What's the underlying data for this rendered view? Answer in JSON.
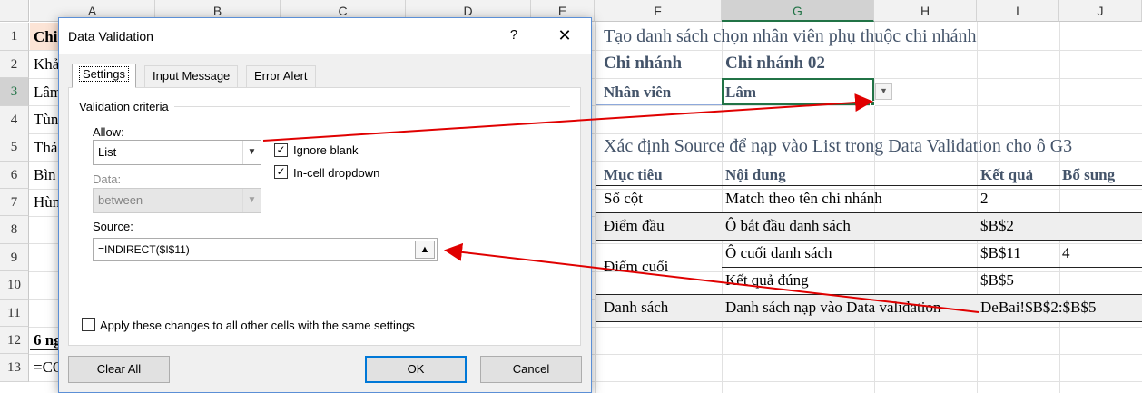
{
  "columns": [
    "A",
    "B",
    "C",
    "D",
    "E",
    "F",
    "G",
    "H",
    "I",
    "J"
  ],
  "rows": [
    "1",
    "2",
    "3",
    "4",
    "5",
    "6",
    "7",
    "8",
    "9",
    "10",
    "11",
    "12",
    "13"
  ],
  "left_cells": {
    "a1": "Chi",
    "a2": "Khả",
    "a3": "Lâm",
    "a4": "Tùn",
    "a5": "Thả",
    "a6": "Bìn",
    "a7": "Hùn",
    "a12": "6 ng",
    "a13": "=CO"
  },
  "right": {
    "title1": "Tạo danh sách chọn nhân viên phụ thuộc chi nhánh",
    "branch_label": "Chi nhánh",
    "branch_value": "Chi nhánh 02",
    "employee_label": "Nhân viên",
    "employee_value": "Lâm",
    "title2": "Xác định Source để nạp vào List trong Data Validation cho ô G3",
    "table_headers": [
      "Mục tiêu",
      "Nội dung",
      "Kết quả",
      "Bổ sung"
    ],
    "table": {
      "r7_goal": "Số cột",
      "r7_content": "Match theo tên chi nhánh",
      "r7_result": "2",
      "r8_goal": "Điểm đầu",
      "r8_content": "Ô bắt đầu danh sách",
      "r8_result": "$B$2",
      "r9_content": "Ô cuối danh sách",
      "r9_result": "$B$11",
      "r9_extra": "4",
      "r910_goal": "Điểm cuối",
      "r10_content": "Kết quả đúng",
      "r10_result": "$B$5",
      "r11_goal": "Danh sách",
      "r11_content": "Danh sách nạp vào Data validation",
      "r11_result": "DeBai!$B$2:$B$5"
    }
  },
  "dialog": {
    "title": "Data Validation",
    "help": "?",
    "close": "✕",
    "tabs": [
      "Settings",
      "Input Message",
      "Error Alert"
    ],
    "group": "Validation criteria",
    "allow_label": "Allow:",
    "allow_value": "List",
    "data_label": "Data:",
    "data_value": "between",
    "ignore_blank": "Ignore blank",
    "in_cell_dropdown": "In-cell dropdown",
    "source_label": "Source:",
    "source_value": "=INDIRECT($I$11)",
    "apply_label": "Apply these changes to all other cells with the same settings",
    "clear_all": "Clear All",
    "ok": "OK",
    "cancel": "Cancel"
  },
  "colors": {
    "excel_green": "#217346",
    "arrow_red": "#e00000",
    "header_blue": "#44546a"
  }
}
